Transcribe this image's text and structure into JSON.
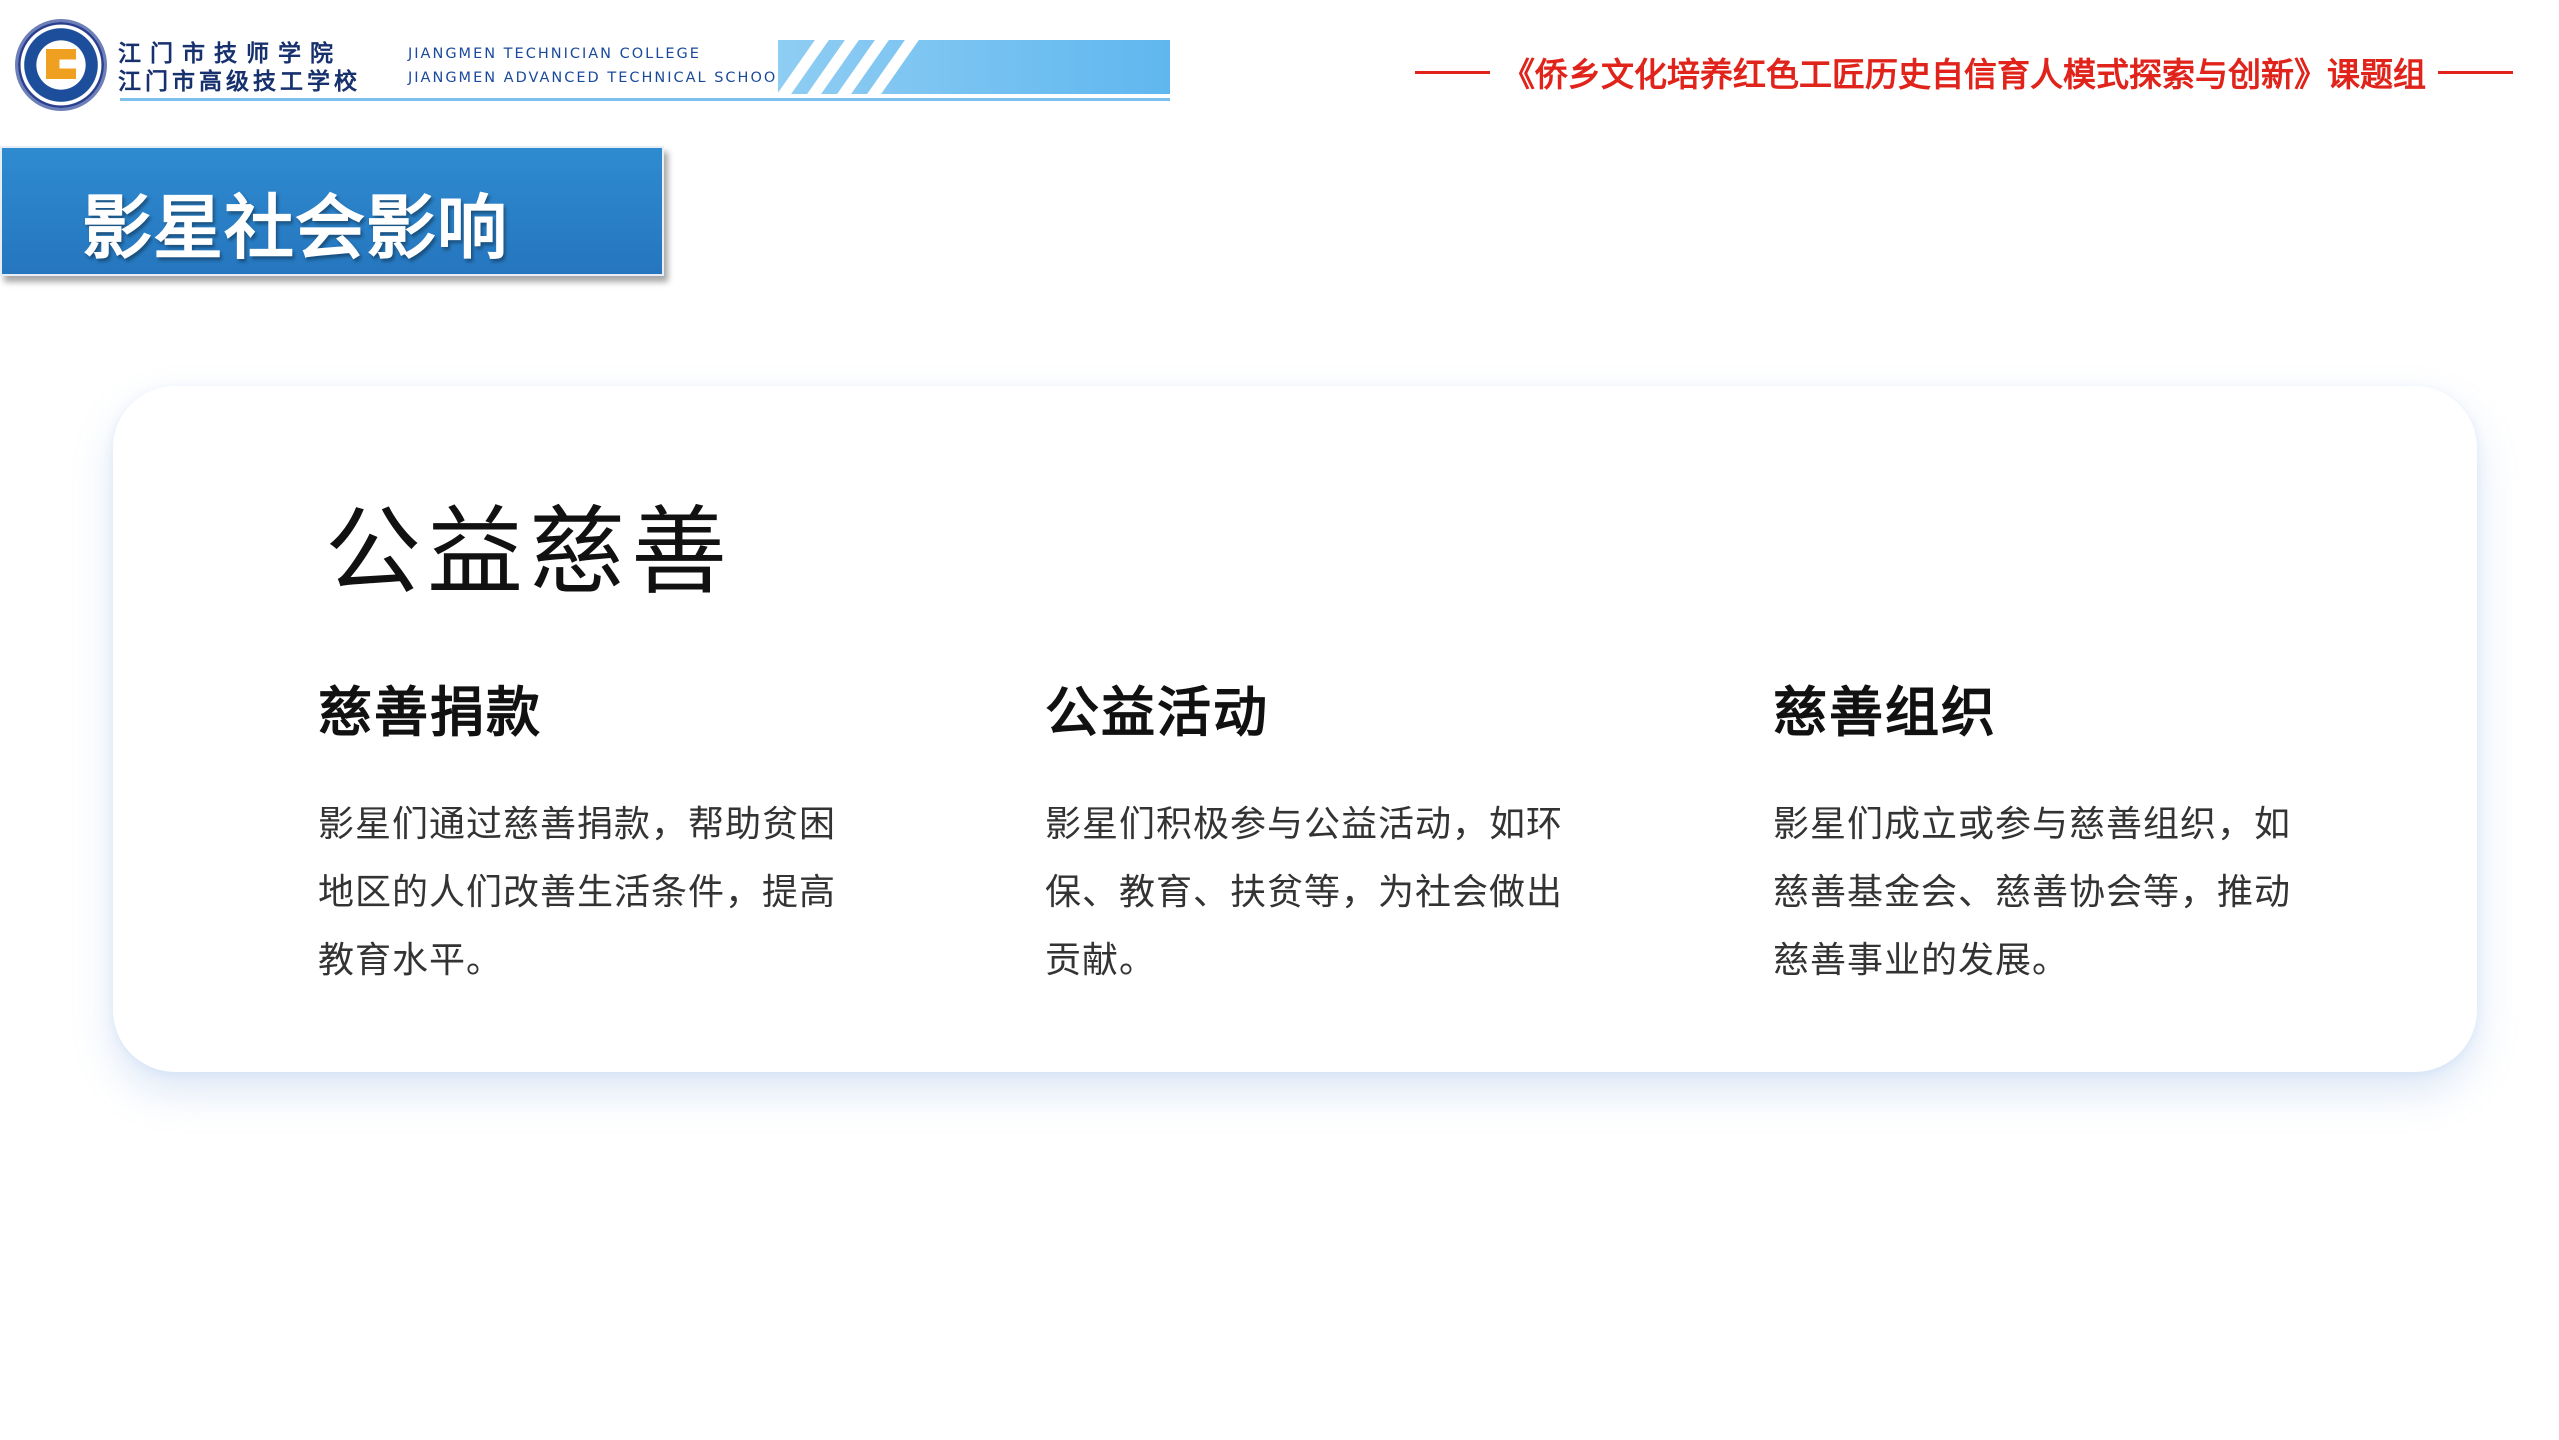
{
  "header": {
    "school_name_cn_1": "江门市技师学院",
    "school_name_cn_2": "江门市高级技工学校",
    "school_name_en_1": "JIANGMEN TECHNICIAN COLLEGE",
    "school_name_en_2": "JIANGMEN ADVANCED TECHNICAL SCHOOL",
    "project_title": "《侨乡文化培养红色工匠历史自信育人模式探索与创新》课题组"
  },
  "section": {
    "title": "影星社会影响"
  },
  "card": {
    "title": "公益慈善",
    "columns": [
      {
        "heading": "慈善捐款",
        "lines": [
          "影星们通过慈善捐款，帮助贫困",
          "地区的人们改善生活条件，提高",
          "教育水平。"
        ]
      },
      {
        "heading": "公益活动",
        "lines": [
          "影星们积极参与公益活动，如环",
          "保、教育、扶贫等，为社会做出",
          "贡献。"
        ]
      },
      {
        "heading": "慈善组织",
        "lines": [
          "影星们成立或参与慈善组织，如",
          "慈善基金会、慈善协会等，推动",
          "慈善事业的发展。"
        ]
      }
    ]
  },
  "colors": {
    "accent_blue": "#2a7fc8",
    "header_red": "#e0241b",
    "school_navy": "#17306e"
  }
}
